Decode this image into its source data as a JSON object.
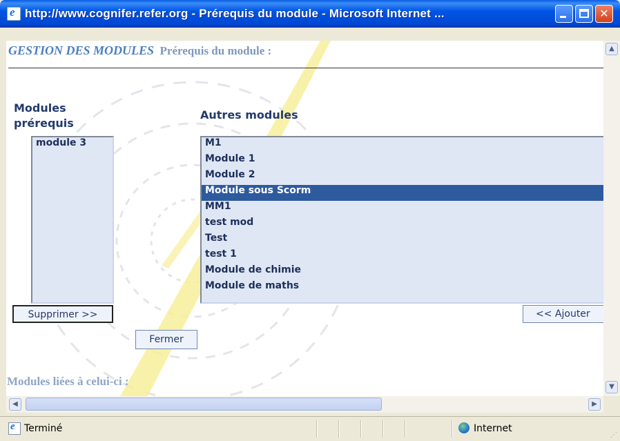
{
  "window": {
    "title": "http://www.cognifer.refer.org - Prérequis du module - Microsoft Internet ..."
  },
  "header": {
    "title": "GESTION DES MODULES",
    "subtitle": "Prérequis du module :"
  },
  "prereq": {
    "label": "Modules prérequis",
    "items": [
      "module 3"
    ]
  },
  "other": {
    "label": "Autres modules",
    "items": [
      {
        "label": "M1",
        "selected": false
      },
      {
        "label": "Module 1",
        "selected": false
      },
      {
        "label": "Module 2",
        "selected": false
      },
      {
        "label": "Module sous Scorm",
        "selected": true
      },
      {
        "label": "MM1",
        "selected": false
      },
      {
        "label": "test mod",
        "selected": false
      },
      {
        "label": "Test",
        "selected": false
      },
      {
        "label": "test 1",
        "selected": false
      },
      {
        "label": "Module de chimie",
        "selected": false
      },
      {
        "label": "Module de maths",
        "selected": false
      }
    ]
  },
  "buttons": {
    "supprimer": "Supprimer >>",
    "ajouter": "<< Ajouter",
    "fermer": "Fermer"
  },
  "footer": {
    "title": "Modules liées à celui-ci :"
  },
  "statusbar": {
    "text": "Terminé",
    "zone": "Internet"
  },
  "colors": {
    "selection": "#2e5a9e",
    "list_bg": "#dfe7f5",
    "header": "#4a7fbf"
  }
}
